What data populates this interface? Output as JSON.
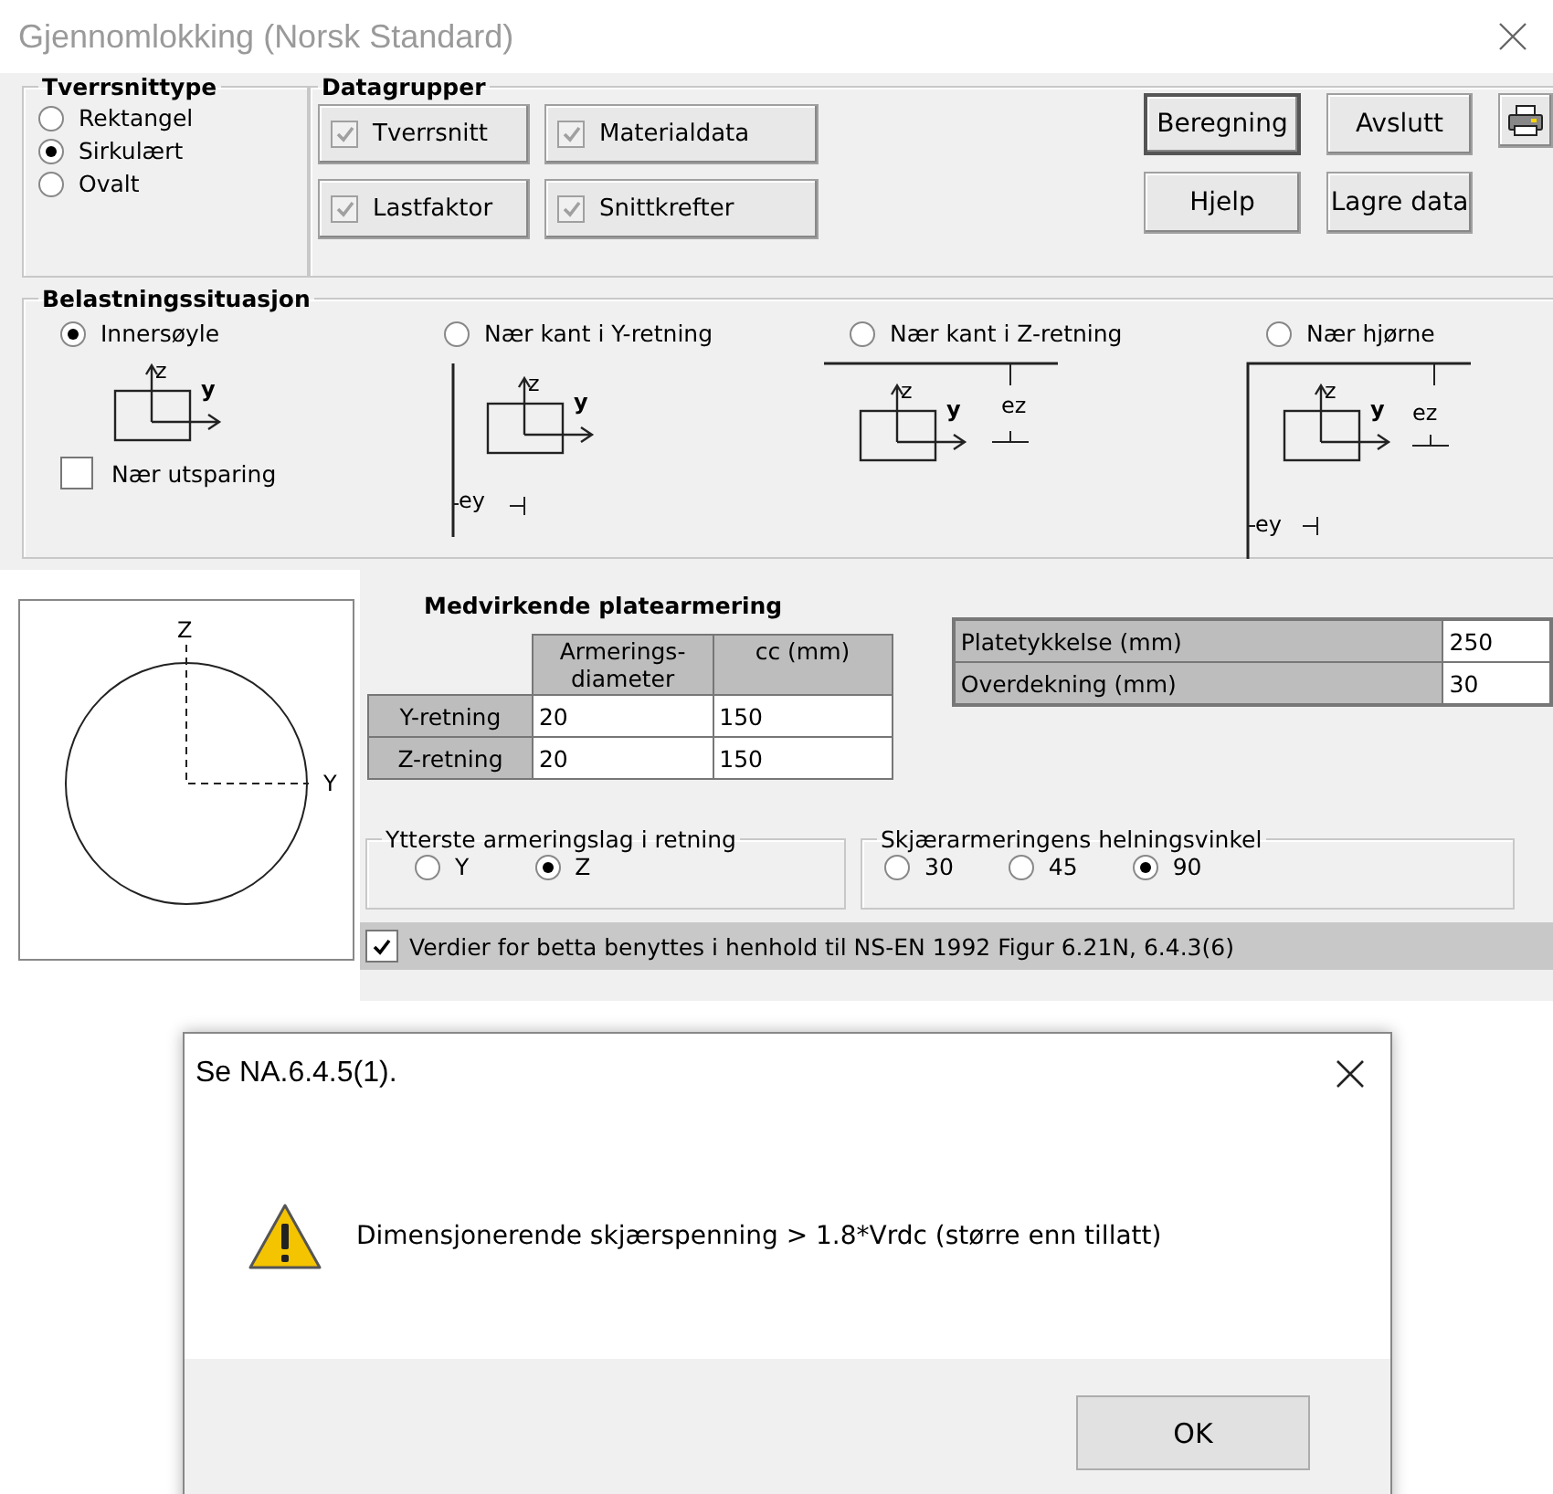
{
  "window": {
    "title": "Gjennomlokking (Norsk Standard)"
  },
  "tverrsnittype": {
    "title": "Tverrsnittype",
    "options": [
      {
        "label": "Rektangel",
        "selected": false
      },
      {
        "label": "Sirkulært",
        "selected": true
      },
      {
        "label": "Ovalt",
        "selected": false
      }
    ]
  },
  "datagrupper": {
    "title": "Datagrupper",
    "buttons": [
      {
        "label": "Tverrsnitt",
        "checked": true
      },
      {
        "label": "Materialdata",
        "checked": true
      },
      {
        "label": "Lastfaktor",
        "checked": true
      },
      {
        "label": "Snittkrefter",
        "checked": true
      }
    ]
  },
  "actions": [
    {
      "kind": "default",
      "label": "Beregning"
    },
    {
      "kind": "normal",
      "label": "Avslutt"
    },
    {
      "kind": "icon"
    },
    {
      "kind": "normal",
      "label": "Hjelp"
    },
    {
      "kind": "normal",
      "label": "Lagre data"
    }
  ],
  "belastning": {
    "title": "Belastningssituasjon",
    "options": [
      {
        "label": "Innersøyle",
        "selected": true,
        "diagram": {
          "kind": "inner",
          "z": "z",
          "y": "y"
        }
      },
      {
        "label": "Nær kant i Y-retning",
        "selected": false,
        "diagram": {
          "kind": "edge_y",
          "z": "z",
          "y": "y",
          "ey": "ey"
        }
      },
      {
        "label": "Nær kant i Z-retning",
        "selected": false,
        "diagram": {
          "kind": "edge_z",
          "z": "z",
          "y": "y",
          "ez": "ez"
        }
      },
      {
        "label": "Nær hjørne",
        "selected": false,
        "diagram": {
          "kind": "corner",
          "z": "z",
          "y": "y",
          "ez": "ez",
          "ey": "ey"
        }
      }
    ],
    "utsparing": {
      "label": "Nær utsparing",
      "checked": false
    }
  },
  "section_view": {
    "z": "Z",
    "y": "Y"
  },
  "platearmering": {
    "title": "Medvirkende platearmering",
    "columns": [
      "Armerings-diameter",
      "cc (mm)"
    ],
    "rows": [
      {
        "label": "Y-retning",
        "values": [
          "20",
          "150"
        ]
      },
      {
        "label": "Z-retning",
        "values": [
          "20",
          "150"
        ]
      }
    ]
  },
  "plate": [
    {
      "label": "Platetykkelse (mm)",
      "value": "250"
    },
    {
      "label": "Overdekning (mm)",
      "value": "30"
    }
  ],
  "ytterste": {
    "title": "Ytterste armeringslag i retning",
    "options": [
      {
        "label": "Y",
        "selected": false
      },
      {
        "label": "Z",
        "selected": true
      }
    ]
  },
  "vinkel": {
    "title": "Skjærarmeringens helningsvinkel",
    "options": [
      {
        "label": "30",
        "selected": false
      },
      {
        "label": "45",
        "selected": false
      },
      {
        "label": "90",
        "selected": true
      }
    ]
  },
  "betta": {
    "label": "Verdier for betta benyttes i henhold til NS-EN 1992 Figur 6.21N, 6.4.3(6)",
    "checked": true
  },
  "dialog": {
    "title": "Se NA.6.4.5(1).",
    "message": "Dimensjonerende skjærspenning > 1.8*Vrdc (større enn tillatt)",
    "button": "OK"
  }
}
